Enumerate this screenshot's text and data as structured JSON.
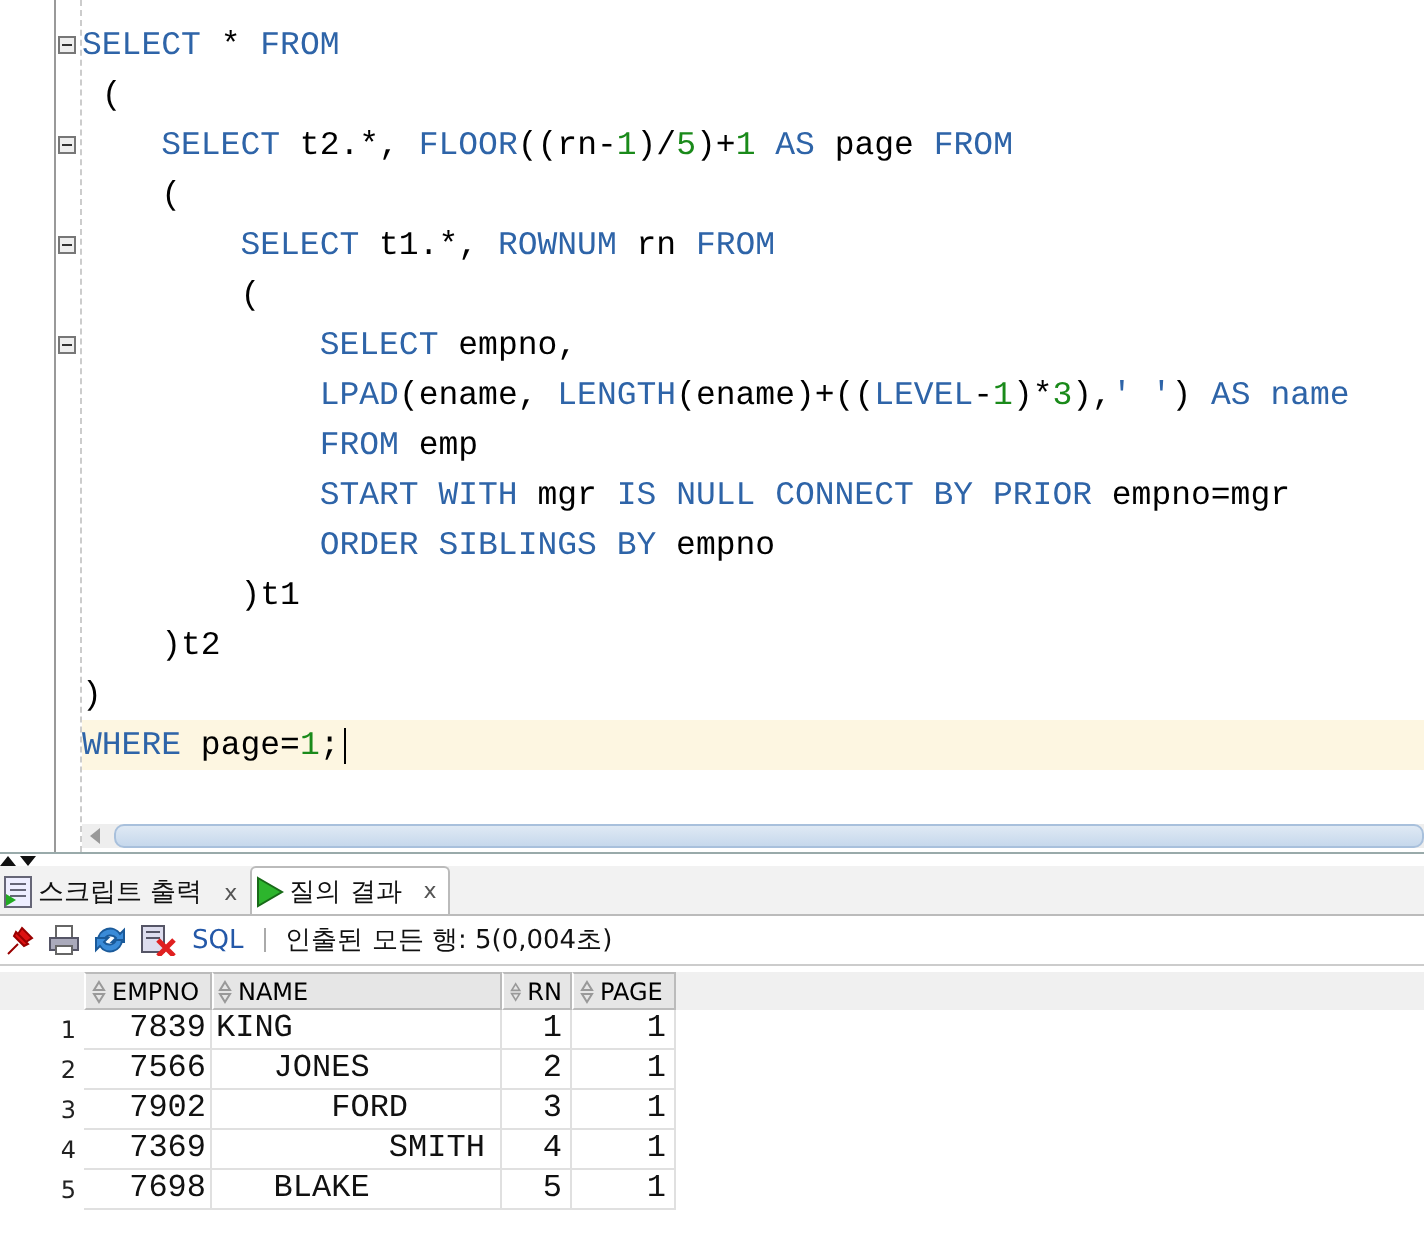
{
  "editor": {
    "lines": [
      {
        "foldable": true,
        "current": false,
        "tokens": [
          {
            "kind": "kw",
            "text": "SELECT"
          },
          {
            "kind": "txt",
            "text": " * "
          },
          {
            "kind": "kw",
            "text": "FROM"
          }
        ]
      },
      {
        "foldable": false,
        "current": false,
        "tokens": [
          {
            "kind": "txt",
            "text": " ("
          }
        ]
      },
      {
        "foldable": true,
        "current": false,
        "tokens": [
          {
            "kind": "kw",
            "text": "    SELECT"
          },
          {
            "kind": "txt",
            "text": " t2.*, "
          },
          {
            "kind": "kw",
            "text": "FLOOR"
          },
          {
            "kind": "txt",
            "text": "((rn-"
          },
          {
            "kind": "num",
            "text": "1"
          },
          {
            "kind": "txt",
            "text": ")/"
          },
          {
            "kind": "num",
            "text": "5"
          },
          {
            "kind": "txt",
            "text": ")+"
          },
          {
            "kind": "num",
            "text": "1"
          },
          {
            "kind": "kw",
            "text": " AS"
          },
          {
            "kind": "txt",
            "text": " page "
          },
          {
            "kind": "kw",
            "text": "FROM"
          }
        ]
      },
      {
        "foldable": false,
        "current": false,
        "tokens": [
          {
            "kind": "txt",
            "text": "    ("
          }
        ]
      },
      {
        "foldable": true,
        "current": false,
        "tokens": [
          {
            "kind": "kw",
            "text": "        SELECT"
          },
          {
            "kind": "txt",
            "text": " t1.*, "
          },
          {
            "kind": "kw",
            "text": "ROWNUM"
          },
          {
            "kind": "txt",
            "text": " rn "
          },
          {
            "kind": "kw",
            "text": "FROM"
          }
        ]
      },
      {
        "foldable": false,
        "current": false,
        "tokens": [
          {
            "kind": "txt",
            "text": "        ("
          }
        ]
      },
      {
        "foldable": true,
        "current": false,
        "tokens": [
          {
            "kind": "kw",
            "text": "            SELECT"
          },
          {
            "kind": "txt",
            "text": " empno,"
          }
        ]
      },
      {
        "foldable": false,
        "current": false,
        "tokens": [
          {
            "kind": "kw",
            "text": "            LPAD"
          },
          {
            "kind": "txt",
            "text": "(ename, "
          },
          {
            "kind": "kw",
            "text": "LENGTH"
          },
          {
            "kind": "txt",
            "text": "(ename)+(("
          },
          {
            "kind": "kw",
            "text": "LEVEL"
          },
          {
            "kind": "txt",
            "text": "-"
          },
          {
            "kind": "num",
            "text": "1"
          },
          {
            "kind": "txt",
            "text": ")*"
          },
          {
            "kind": "num",
            "text": "3"
          },
          {
            "kind": "txt",
            "text": "),"
          },
          {
            "kind": "str",
            "text": "' '"
          },
          {
            "kind": "txt",
            "text": ") "
          },
          {
            "kind": "kw",
            "text": "AS name"
          }
        ]
      },
      {
        "foldable": false,
        "current": false,
        "tokens": [
          {
            "kind": "kw",
            "text": "            FROM"
          },
          {
            "kind": "txt",
            "text": " emp"
          }
        ]
      },
      {
        "foldable": false,
        "current": false,
        "tokens": [
          {
            "kind": "kw",
            "text": "            START WITH"
          },
          {
            "kind": "txt",
            "text": " mgr "
          },
          {
            "kind": "kw",
            "text": "IS NULL CONNECT BY PRIOR"
          },
          {
            "kind": "txt",
            "text": " empno=mgr"
          }
        ]
      },
      {
        "foldable": false,
        "current": false,
        "tokens": [
          {
            "kind": "kw",
            "text": "            ORDER SIBLINGS BY"
          },
          {
            "kind": "txt",
            "text": " empno"
          }
        ]
      },
      {
        "foldable": false,
        "current": false,
        "tokens": [
          {
            "kind": "txt",
            "text": "        )t1"
          }
        ]
      },
      {
        "foldable": false,
        "current": false,
        "tokens": [
          {
            "kind": "txt",
            "text": "    )t2"
          }
        ]
      },
      {
        "foldable": false,
        "current": false,
        "tokens": [
          {
            "kind": "txt",
            "text": ")"
          }
        ]
      },
      {
        "foldable": false,
        "current": true,
        "tokens": [
          {
            "kind": "kw",
            "text": "WHERE"
          },
          {
            "kind": "txt",
            "text": " page="
          },
          {
            "kind": "num",
            "text": "1"
          },
          {
            "kind": "txt",
            "text": ";"
          }
        ]
      }
    ]
  },
  "tabs": [
    {
      "label": "스크립트 출력",
      "close": "x",
      "selected": false
    },
    {
      "label": "질의 결과",
      "close": "x",
      "selected": true
    }
  ],
  "toolbar": {
    "sql_link": "SQL",
    "status": "인출된 모든 행: 5(0,004초)"
  },
  "table": {
    "columns": [
      "EMPNO",
      "NAME",
      "RN",
      "PAGE"
    ],
    "rows": [
      {
        "num": "1",
        "cells": [
          "7839",
          "KING",
          "1",
          "1"
        ]
      },
      {
        "num": "2",
        "cells": [
          "7566",
          "   JONES",
          "2",
          "1"
        ]
      },
      {
        "num": "3",
        "cells": [
          "7902",
          "      FORD",
          "3",
          "1"
        ]
      },
      {
        "num": "4",
        "cells": [
          "7369",
          "         SMITH",
          "4",
          "1"
        ]
      },
      {
        "num": "5",
        "cells": [
          "7698",
          "   BLAKE",
          "5",
          "1"
        ]
      }
    ]
  }
}
